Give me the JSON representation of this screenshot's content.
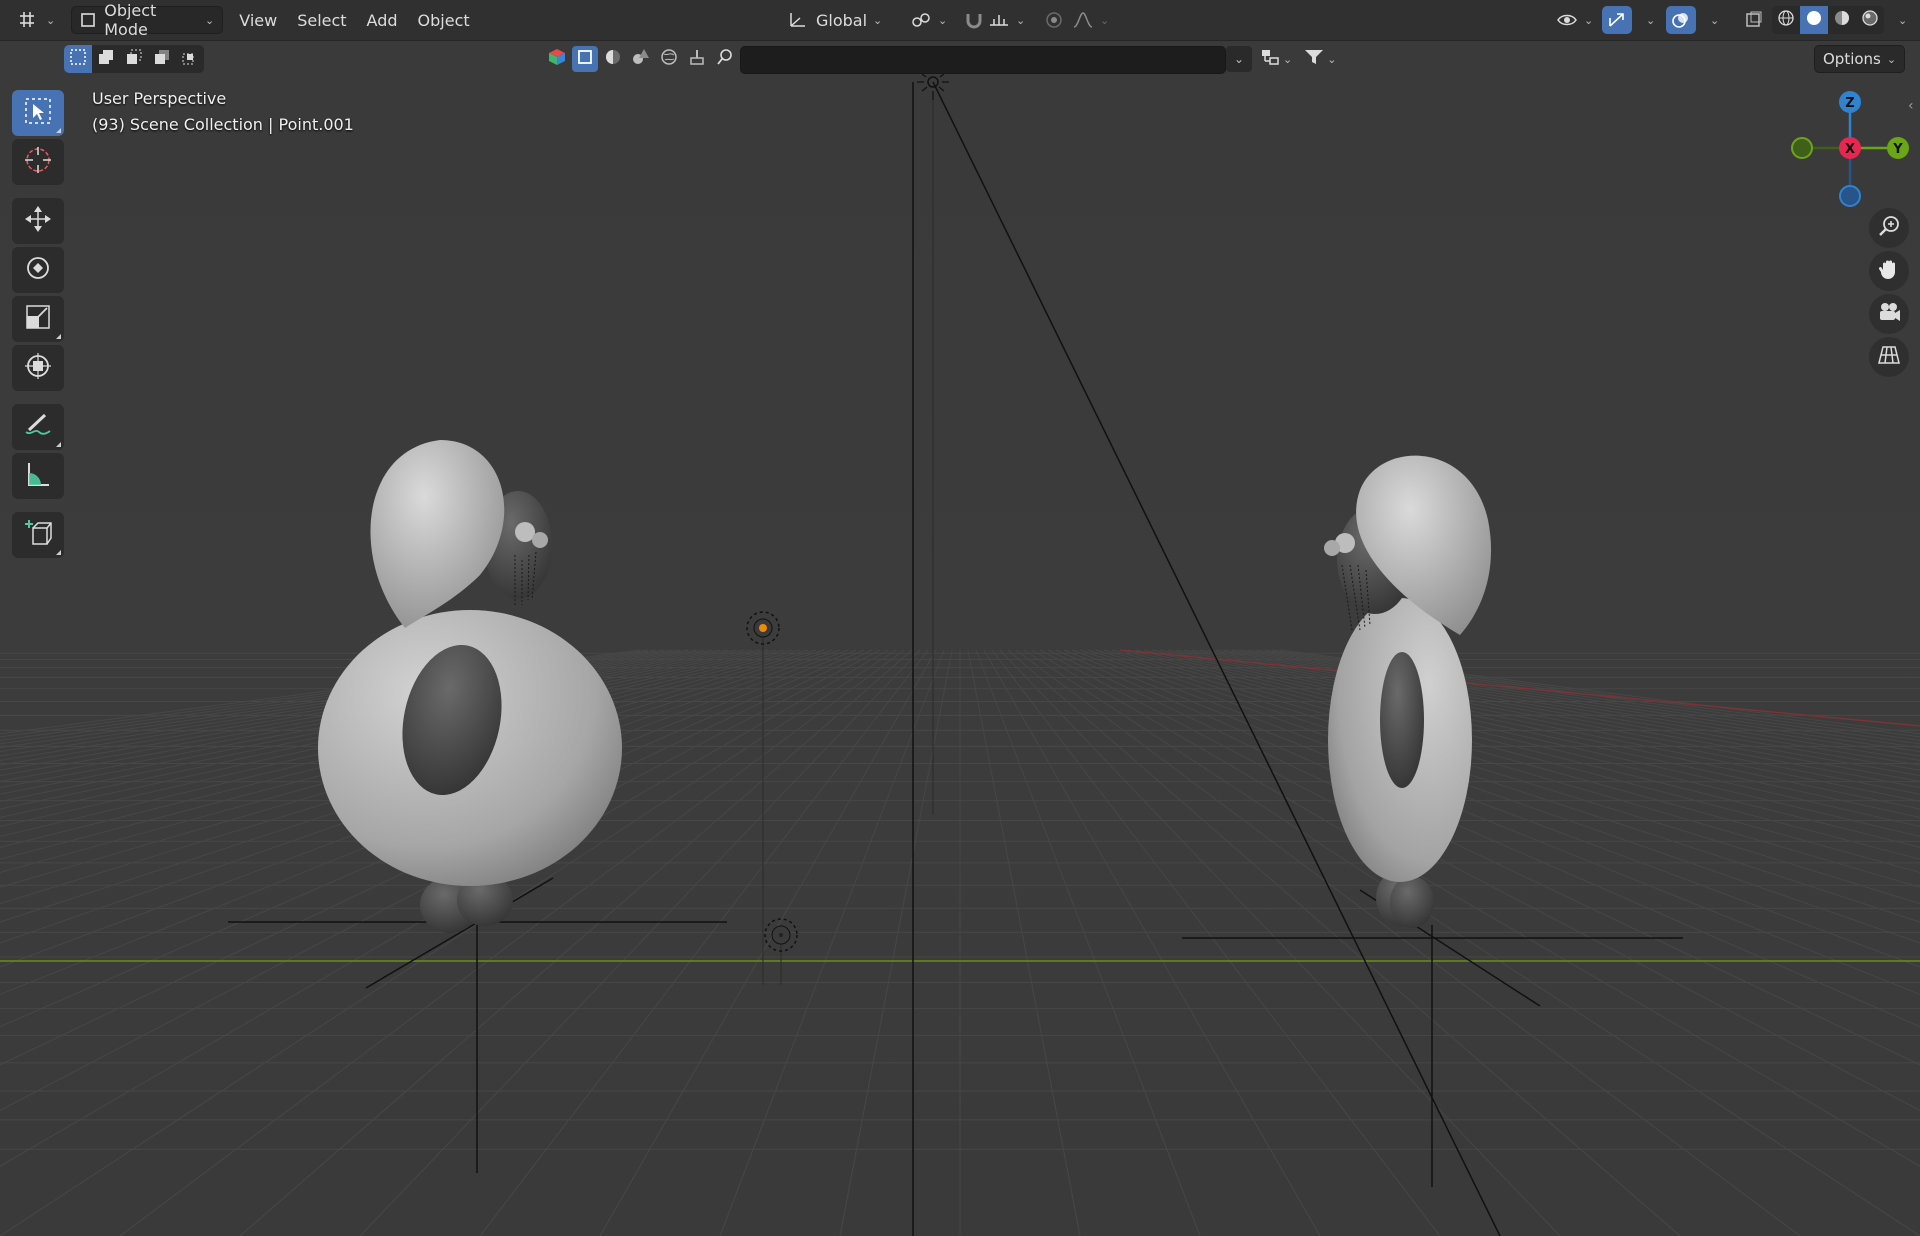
{
  "header": {
    "editor_type_icon": "editor-type-icon",
    "mode_label": "Object Mode",
    "menus": [
      "View",
      "Select",
      "Add",
      "Object"
    ],
    "orientation_label": "Global",
    "options_label": "Options"
  },
  "overlay": {
    "view_name": "User Perspective",
    "scene_info": "(93) Scene Collection | Point.001"
  },
  "gizmo": {
    "z_label": "Z",
    "y_label": "Y",
    "x_label": "X",
    "colors": {
      "x": "#e8264f",
      "y": "#6aa615",
      "z": "#2f83d1"
    }
  },
  "colors": {
    "accent": "#4772b3",
    "viewport_bg": "#3b3b3b",
    "header_bg": "#303030",
    "grid_line": "#474747",
    "x_axis": "#a03034",
    "y_axis": "#6a8c21",
    "light_selected": "#f08a00"
  },
  "toolbar_tools": [
    "select-box-tool",
    "cursor-tool",
    "move-tool",
    "rotate-tool",
    "scale-tool",
    "transform-tool",
    "annotate-tool",
    "measure-tool",
    "add-cube-tool"
  ],
  "nav_buttons": [
    "zoom-icon",
    "hand-pan-icon",
    "camera-icon",
    "grid-ortho-icon"
  ]
}
